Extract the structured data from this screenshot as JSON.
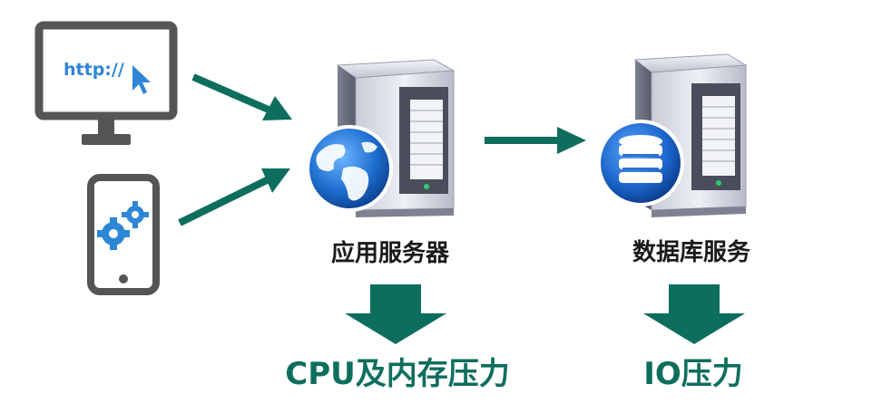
{
  "client": {
    "monitor_text": "http://",
    "monitor_icon": "cursor-arrow-icon",
    "phone_icon": "gears-icon"
  },
  "app_server": {
    "label": "应用服务器",
    "badge_icon": "globe-icon",
    "pressure": "CPU及内存压力"
  },
  "db_server": {
    "label": "数据库服务",
    "badge_icon": "database-icon",
    "pressure": "IO压力"
  },
  "colors": {
    "arrow": "#0e6e5e",
    "label": "#1a1a1a",
    "pressure_text": "#0e6e5e",
    "monitor_text": "#2f86d6",
    "badge_blue": "#1f6fd1"
  }
}
